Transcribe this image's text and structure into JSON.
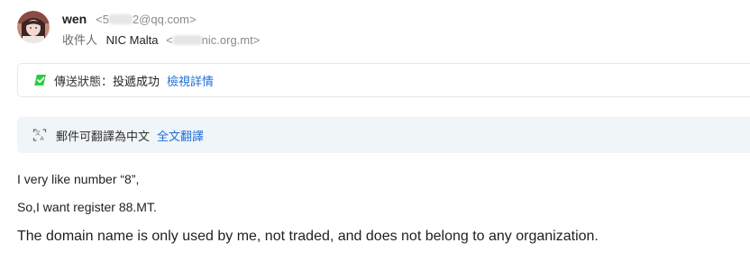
{
  "header": {
    "sender_name": "wen",
    "sender_email_prefix": "<5",
    "sender_email_suffix": "2@qq.com>",
    "recipient_label": "收件人",
    "recipient_name": "NIC Malta",
    "recipient_email_prefix": "<",
    "recipient_email_suffix": "nic.org.mt>"
  },
  "status": {
    "icon": "check-icon",
    "label": "傳送狀態：",
    "value": "投遞成功",
    "link": "檢視詳情",
    "accent": "#2ecc40"
  },
  "translate": {
    "icon": "translate-icon",
    "text": "郵件可翻譯為中文",
    "link": "全文翻譯"
  },
  "body": {
    "line1": "I very like number “8”,",
    "line2": "So,I want register 88.MT.",
    "line3": "The domain name is only used by me, not traded, and does not belong to any organization."
  },
  "colors": {
    "link": "#1e6fd9",
    "translate_bg": "#f0f5f8",
    "muted": "#8a8a8a"
  }
}
